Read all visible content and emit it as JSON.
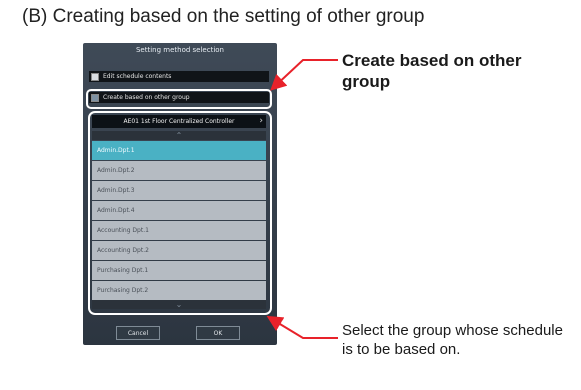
{
  "heading": "(B) Creating based on the setting of other group",
  "dialog": {
    "title": "Setting method selection",
    "options": [
      {
        "label": "Edit schedule contents",
        "checked": false
      },
      {
        "label": "Create based on other group",
        "checked": true
      }
    ],
    "controller": "AE01 1st Floor Centralized Controller",
    "groups": [
      "Admin.Dpt.1",
      "Admin.Dpt.2",
      "Admin.Dpt.3",
      "Admin.Dpt.4",
      "Accounting Dpt.1",
      "Accounting Dpt.2",
      "Purchasing Dpt.1",
      "Purchasing Dpt.2"
    ],
    "selected_group": "Admin.Dpt.1",
    "cancel_label": "Cancel",
    "ok_label": "OK"
  },
  "annotations": {
    "create_based": "Create based on other group",
    "select_group": "Select the group whose schedule is to be based on."
  },
  "colors": {
    "arrow": "#e8222a",
    "selected_row": "#4ab1c4"
  },
  "icons": {
    "controller_next": "chevron-right-icon",
    "scroll_up": "chevron-up-icon",
    "scroll_down": "chevron-down-icon"
  }
}
